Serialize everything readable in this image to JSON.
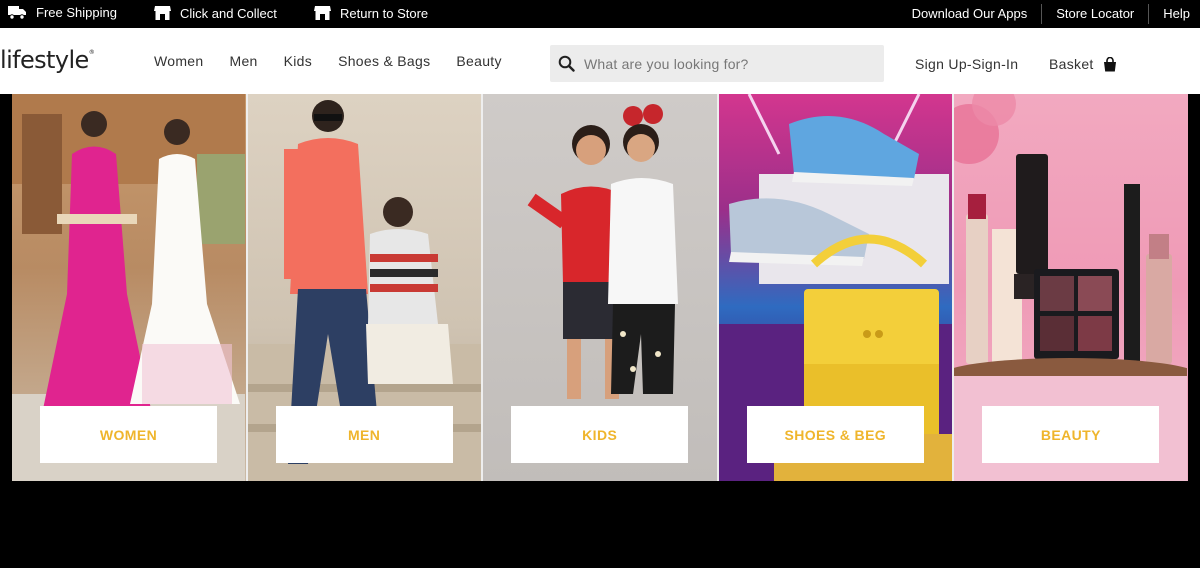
{
  "topbar": {
    "perks": [
      {
        "label": "Free Shipping",
        "icon": "truck-icon"
      },
      {
        "label": "Click and Collect",
        "icon": "store-icon"
      },
      {
        "label": "Return to Store",
        "icon": "store-return-icon"
      }
    ],
    "links": [
      "Download Our Apps",
      "Store Locator",
      "Help"
    ]
  },
  "header": {
    "logo": "lifestyle",
    "nav": [
      "Women",
      "Men",
      "Kids",
      "Shoes & Bags",
      "Beauty"
    ],
    "search_placeholder": "What are you looking for?",
    "account": "Sign Up-Sign-In",
    "basket": "Basket"
  },
  "categories": [
    {
      "label": "WOMEN"
    },
    {
      "label": "MEN"
    },
    {
      "label": "KIDS"
    },
    {
      "label": "SHOES & BEG"
    },
    {
      "label": "BEAUTY"
    }
  ],
  "colors": {
    "accent": "#efb52c",
    "topbar_bg": "#000000",
    "search_bg": "#ececec"
  }
}
